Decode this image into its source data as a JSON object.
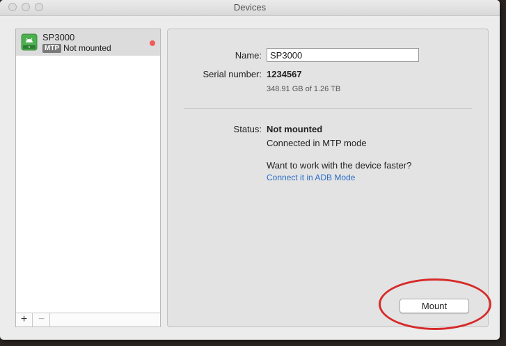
{
  "window": {
    "title": "Devices"
  },
  "sidebar": {
    "devices": [
      {
        "name": "SP3000",
        "badge": "MTP",
        "status": "Not mounted",
        "icon": "android-drive-icon",
        "status_color": "#ef5b5b"
      }
    ],
    "add_label": "+",
    "remove_label": "−"
  },
  "detail": {
    "name_label": "Name:",
    "name_value": "SP3000",
    "serial_label": "Serial number:",
    "serial_value": "1234567",
    "storage": "348.91 GB of 1.26 TB",
    "status_label": "Status:",
    "status_value": "Not mounted",
    "connection": "Connected in MTP mode",
    "prompt": "Want to work with the device faster?",
    "link": "Connect it in ADB Mode",
    "mount_button": "Mount"
  },
  "colors": {
    "link": "#2a6ec7",
    "annotation": "#d72a2a",
    "icon_green": "#4caf50"
  }
}
